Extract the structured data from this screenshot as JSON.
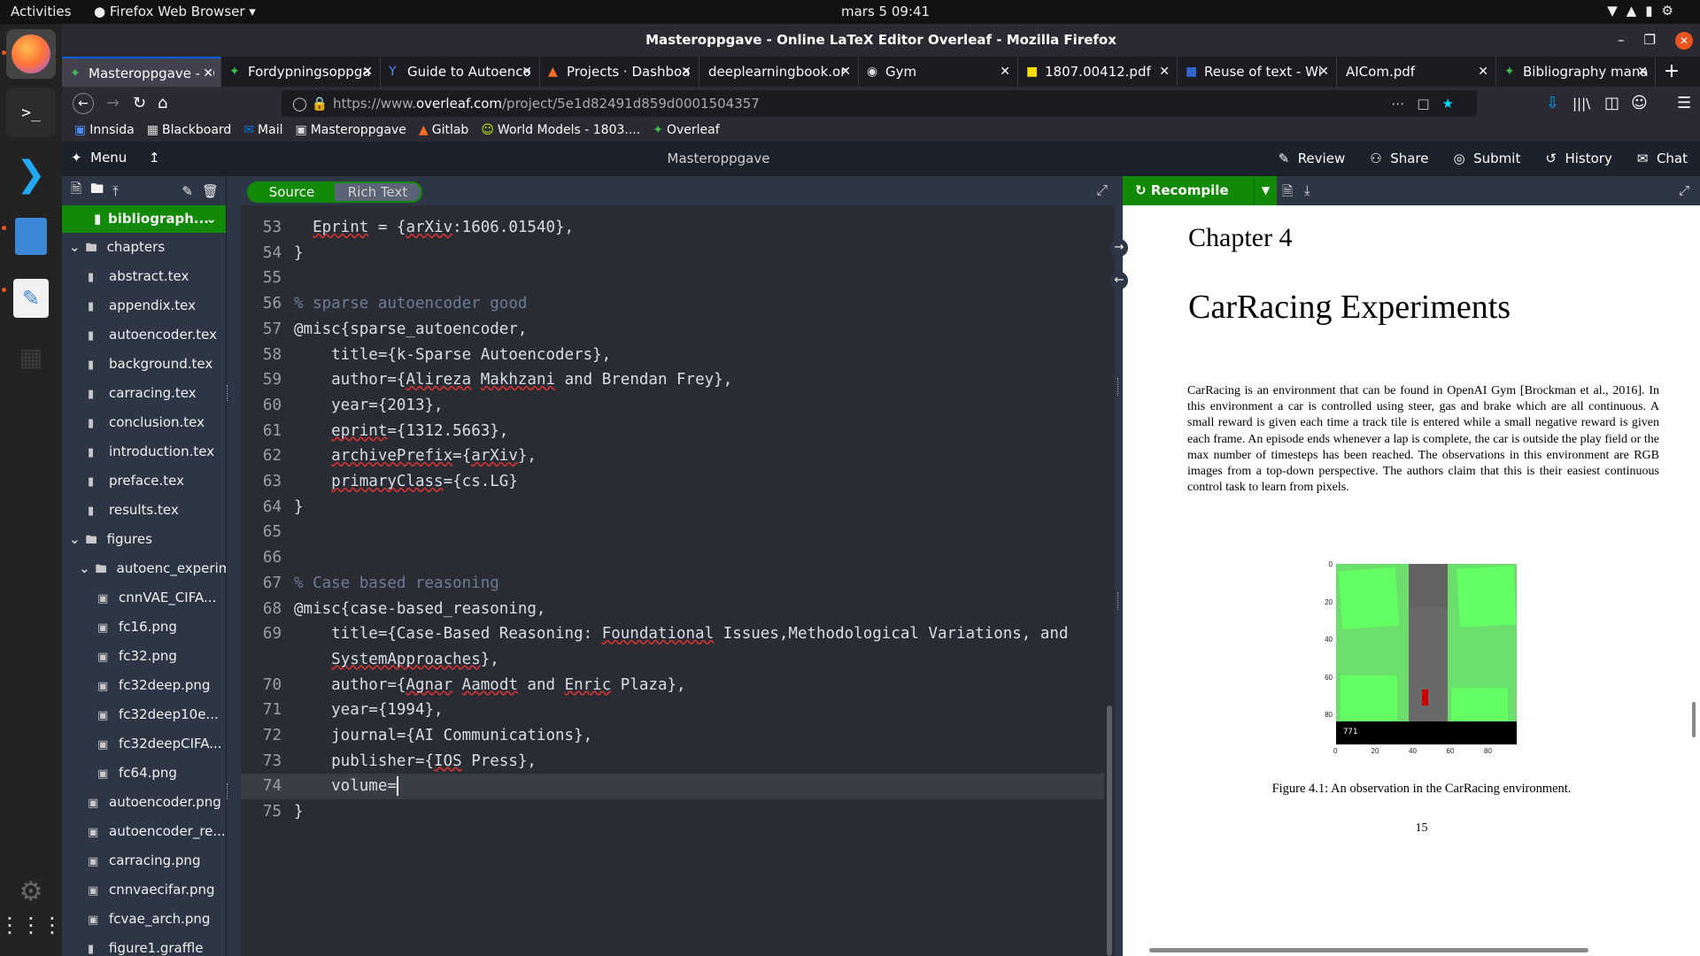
{
  "topbar": {
    "activities": "Activities",
    "app_name": "Firefox Web Browser",
    "clock": "mars 5  09:41"
  },
  "window": {
    "title": "Masteroppgave - Online LaTeX Editor Overleaf - Mozilla Firefox"
  },
  "tabs": [
    {
      "label": "Masteroppgave - O",
      "icon": "overleaf-icon"
    },
    {
      "label": "Fordypningsoppga",
      "icon": "overleaf-icon"
    },
    {
      "label": "Guide to Autoenco",
      "icon": "y-icon"
    },
    {
      "label": "Projects · Dashboa",
      "icon": "gitlab-icon"
    },
    {
      "label": "deeplearningbook.or",
      "icon": "none"
    },
    {
      "label": "Gym",
      "icon": "gym-icon"
    },
    {
      "label": "1807.00412.pdf",
      "icon": "pdf-icon"
    },
    {
      "label": "Reuse of text - Wi",
      "icon": "web-icon"
    },
    {
      "label": "AICom.pdf",
      "icon": "none"
    },
    {
      "label": "Bibliography mana",
      "icon": "overleaf-icon"
    }
  ],
  "url": {
    "prefix": "https://www.",
    "domain": "overleaf.com",
    "path": "/project/5e1d82491d859d0001504357"
  },
  "bookmarks": [
    "Innsida",
    "Blackboard",
    "Mail",
    "Masteroppgave",
    "Gitlab",
    "World Models - 1803....",
    "Overleaf"
  ],
  "overleaf": {
    "menu": "Menu",
    "project_title": "Masteroppgave",
    "actions": [
      "Review",
      "Share",
      "Submit",
      "History",
      "Chat"
    ],
    "source_label": "Source",
    "rich_text_label": "Rich Text",
    "recompile_label": "Recompile"
  },
  "file_tree": {
    "selected": "bibliograph...",
    "rows": [
      {
        "name": "chapters",
        "kind": "folder",
        "depth": 0
      },
      {
        "name": "abstract.tex",
        "kind": "file",
        "depth": 1
      },
      {
        "name": "appendix.tex",
        "kind": "file",
        "depth": 1
      },
      {
        "name": "autoencoder.tex",
        "kind": "file",
        "depth": 1
      },
      {
        "name": "background.tex",
        "kind": "file",
        "depth": 1
      },
      {
        "name": "carracing.tex",
        "kind": "file",
        "depth": 1
      },
      {
        "name": "conclusion.tex",
        "kind": "file",
        "depth": 1
      },
      {
        "name": "introduction.tex",
        "kind": "file",
        "depth": 1
      },
      {
        "name": "preface.tex",
        "kind": "file",
        "depth": 1
      },
      {
        "name": "results.tex",
        "kind": "file",
        "depth": 1
      },
      {
        "name": "figures",
        "kind": "folder",
        "depth": 0
      },
      {
        "name": "autoenc_experime",
        "kind": "folder",
        "depth": 1
      },
      {
        "name": "cnnVAE_CIFA...",
        "kind": "image",
        "depth": 2
      },
      {
        "name": "fc16.png",
        "kind": "image",
        "depth": 2
      },
      {
        "name": "fc32.png",
        "kind": "image",
        "depth": 2
      },
      {
        "name": "fc32deep.png",
        "kind": "image",
        "depth": 2
      },
      {
        "name": "fc32deep10e...",
        "kind": "image",
        "depth": 2
      },
      {
        "name": "fc32deepCIFA...",
        "kind": "image",
        "depth": 2
      },
      {
        "name": "fc64.png",
        "kind": "image",
        "depth": 2
      },
      {
        "name": "autoencoder.png",
        "kind": "image",
        "depth": 1
      },
      {
        "name": "autoencoder_re...",
        "kind": "image",
        "depth": 1
      },
      {
        "name": "carracing.png",
        "kind": "image",
        "depth": 1
      },
      {
        "name": "cnnvaecifar.png",
        "kind": "image",
        "depth": 1
      },
      {
        "name": "fcvae_arch.png",
        "kind": "image",
        "depth": 1
      },
      {
        "name": "figure1.graffle",
        "kind": "file",
        "depth": 1
      }
    ]
  },
  "editor": {
    "lines": [
      {
        "n": "53",
        "segs": [
          [
            "  ",
            ""
          ],
          [
            "Eprint",
            "sq"
          ],
          [
            " = {",
            ""
          ],
          [
            "arXiv",
            "sq"
          ],
          [
            ":1606.01540},",
            ""
          ]
        ]
      },
      {
        "n": "54",
        "segs": [
          [
            "}",
            ""
          ]
        ]
      },
      {
        "n": "55",
        "segs": []
      },
      {
        "n": "56",
        "segs": [
          [
            "% sparse autoencoder good",
            "cm"
          ]
        ]
      },
      {
        "n": "57",
        "segs": [
          [
            "@misc{sparse_autoencoder,",
            ""
          ]
        ]
      },
      {
        "n": "58",
        "segs": [
          [
            "    title={k-Sparse Autoencoders},",
            ""
          ]
        ]
      },
      {
        "n": "59",
        "segs": [
          [
            "    author={",
            ""
          ],
          [
            "Alireza",
            "sq"
          ],
          [
            " ",
            ""
          ],
          [
            "Makhzani",
            "sq"
          ],
          [
            " and Brendan Frey},",
            ""
          ]
        ]
      },
      {
        "n": "60",
        "segs": [
          [
            "    year={2013},",
            ""
          ]
        ]
      },
      {
        "n": "61",
        "segs": [
          [
            "    ",
            ""
          ],
          [
            "eprint",
            "sq"
          ],
          [
            "={1312.5663},",
            ""
          ]
        ]
      },
      {
        "n": "62",
        "segs": [
          [
            "    ",
            ""
          ],
          [
            "archivePrefix",
            "sq"
          ],
          [
            "={",
            ""
          ],
          [
            "arXiv",
            "sq"
          ],
          [
            "},",
            ""
          ]
        ]
      },
      {
        "n": "63",
        "segs": [
          [
            "    ",
            ""
          ],
          [
            "primaryClass",
            "sq"
          ],
          [
            "={cs.LG}",
            ""
          ]
        ]
      },
      {
        "n": "64",
        "segs": [
          [
            "}",
            ""
          ]
        ]
      },
      {
        "n": "65",
        "segs": []
      },
      {
        "n": "66",
        "segs": []
      },
      {
        "n": "67",
        "segs": [
          [
            "% Case based reasoning",
            "cm"
          ]
        ]
      },
      {
        "n": "68",
        "segs": [
          [
            "@misc{case-based_reasoning,",
            ""
          ]
        ]
      },
      {
        "n": "69",
        "segs": [
          [
            "    title={Case-Based Reasoning: ",
            ""
          ],
          [
            "Foundational",
            "sq"
          ],
          [
            " Issues,Methodological Variations, and",
            ""
          ]
        ]
      },
      {
        "n": "",
        "segs": [
          [
            "    ",
            ""
          ],
          [
            "SystemApproaches",
            "sq"
          ],
          [
            "},",
            ""
          ]
        ]
      },
      {
        "n": "70",
        "segs": [
          [
            "    author={",
            ""
          ],
          [
            "Agnar",
            "sq"
          ],
          [
            " ",
            ""
          ],
          [
            "Aamodt",
            "sq"
          ],
          [
            " and ",
            ""
          ],
          [
            "Enric",
            "sq"
          ],
          [
            " Plaza},",
            ""
          ]
        ]
      },
      {
        "n": "71",
        "segs": [
          [
            "    year={1994},",
            ""
          ]
        ]
      },
      {
        "n": "72",
        "segs": [
          [
            "    journal={AI Communications},",
            ""
          ]
        ]
      },
      {
        "n": "73",
        "segs": [
          [
            "    publisher={",
            ""
          ],
          [
            "IOS",
            "sq"
          ],
          [
            " Press},",
            ""
          ]
        ]
      },
      {
        "n": "74",
        "segs": [
          [
            "    volume=",
            ""
          ]
        ],
        "current": true
      },
      {
        "n": "75",
        "segs": [
          [
            "}",
            ""
          ]
        ]
      }
    ]
  },
  "pdf": {
    "chapter": "Chapter 4",
    "title": "CarRacing Experiments",
    "paragraph": "CarRacing is an environment that can be found in OpenAI Gym [Brockman et al., 2016]. In this environment a car is controlled using steer, gas and brake which are all continuous. A small reward is given each time a track tile is entered while a small negative reward is given each frame. An episode ends whenever a lap is complete, the car is outside the play field or the max number of timesteps has been reached. The observations in this environment are RGB images from a top-down perspective. The authors claim that this is their easiest continuous control task to learn from pixels.",
    "figure_yticks": [
      "0",
      "20",
      "40",
      "60",
      "80"
    ],
    "figure_xticks": [
      "0",
      "20",
      "40",
      "60",
      "80"
    ],
    "figure_hud": "771",
    "caption": "Figure 4.1: An observation in the CarRacing environment.",
    "page_number": "15"
  }
}
